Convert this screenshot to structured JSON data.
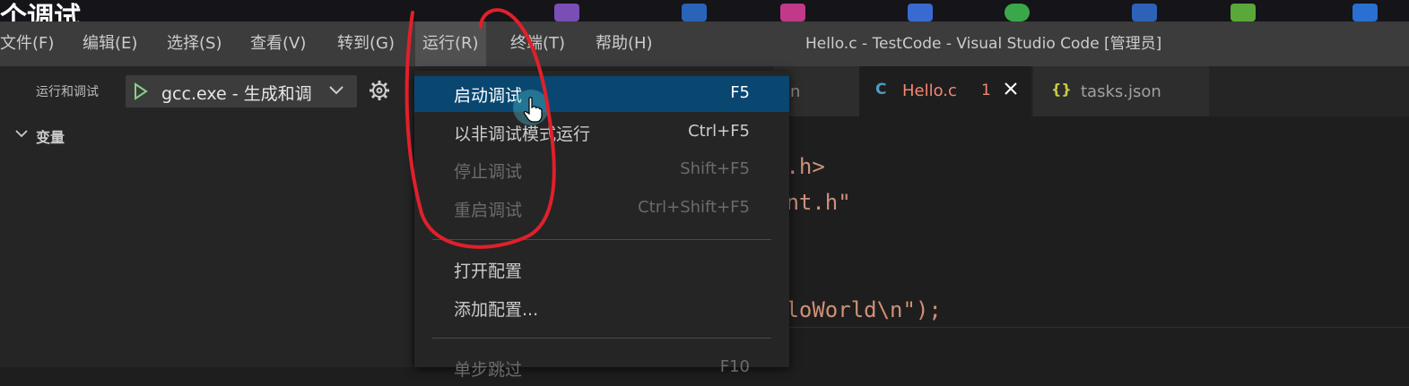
{
  "overlay_text": "个调试",
  "menubar": {
    "items": [
      "文件(F)",
      "编辑(E)",
      "选择(S)",
      "查看(V)",
      "转到(G)",
      "运行(R)",
      "终端(T)",
      "帮助(H)"
    ],
    "active_index": 5
  },
  "window_title": "Hello.c - TestCode - Visual Studio Code [管理员]",
  "sidebar": {
    "title": "运行和调试",
    "config": "gcc.exe - 生成和调",
    "section": "变量"
  },
  "tabs": [
    {
      "label": "on",
      "type": "json"
    },
    {
      "label": "Hello.c",
      "icon": "C",
      "problems": "1",
      "active": true
    },
    {
      "label": "tasks.json",
      "icon": "{}"
    }
  ],
  "code_lines": [
    "o.h>",
    "ent.h\"",
    "lloWorld\\n\");"
  ],
  "run_menu": {
    "items": [
      {
        "label": "启动调试",
        "shortcut": "F5",
        "state": "selected"
      },
      {
        "label": "以非调试模式运行",
        "shortcut": "Ctrl+F5",
        "state": "enabled"
      },
      {
        "label": "停止调试",
        "shortcut": "Shift+F5",
        "state": "disabled"
      },
      {
        "label": "重启调试",
        "shortcut": "Ctrl+Shift+F5",
        "state": "disabled"
      },
      {
        "label": "打开配置",
        "shortcut": "",
        "state": "enabled"
      },
      {
        "label": "添加配置...",
        "shortcut": "",
        "state": "enabled"
      },
      {
        "label": "单步跳过",
        "shortcut": "F10",
        "state": "disabled"
      }
    ]
  },
  "colors": {
    "menu_selected": "#094771",
    "titlebar": "#3c3c3c",
    "annotation": "#e0202a",
    "tab_error": "#f48771"
  }
}
